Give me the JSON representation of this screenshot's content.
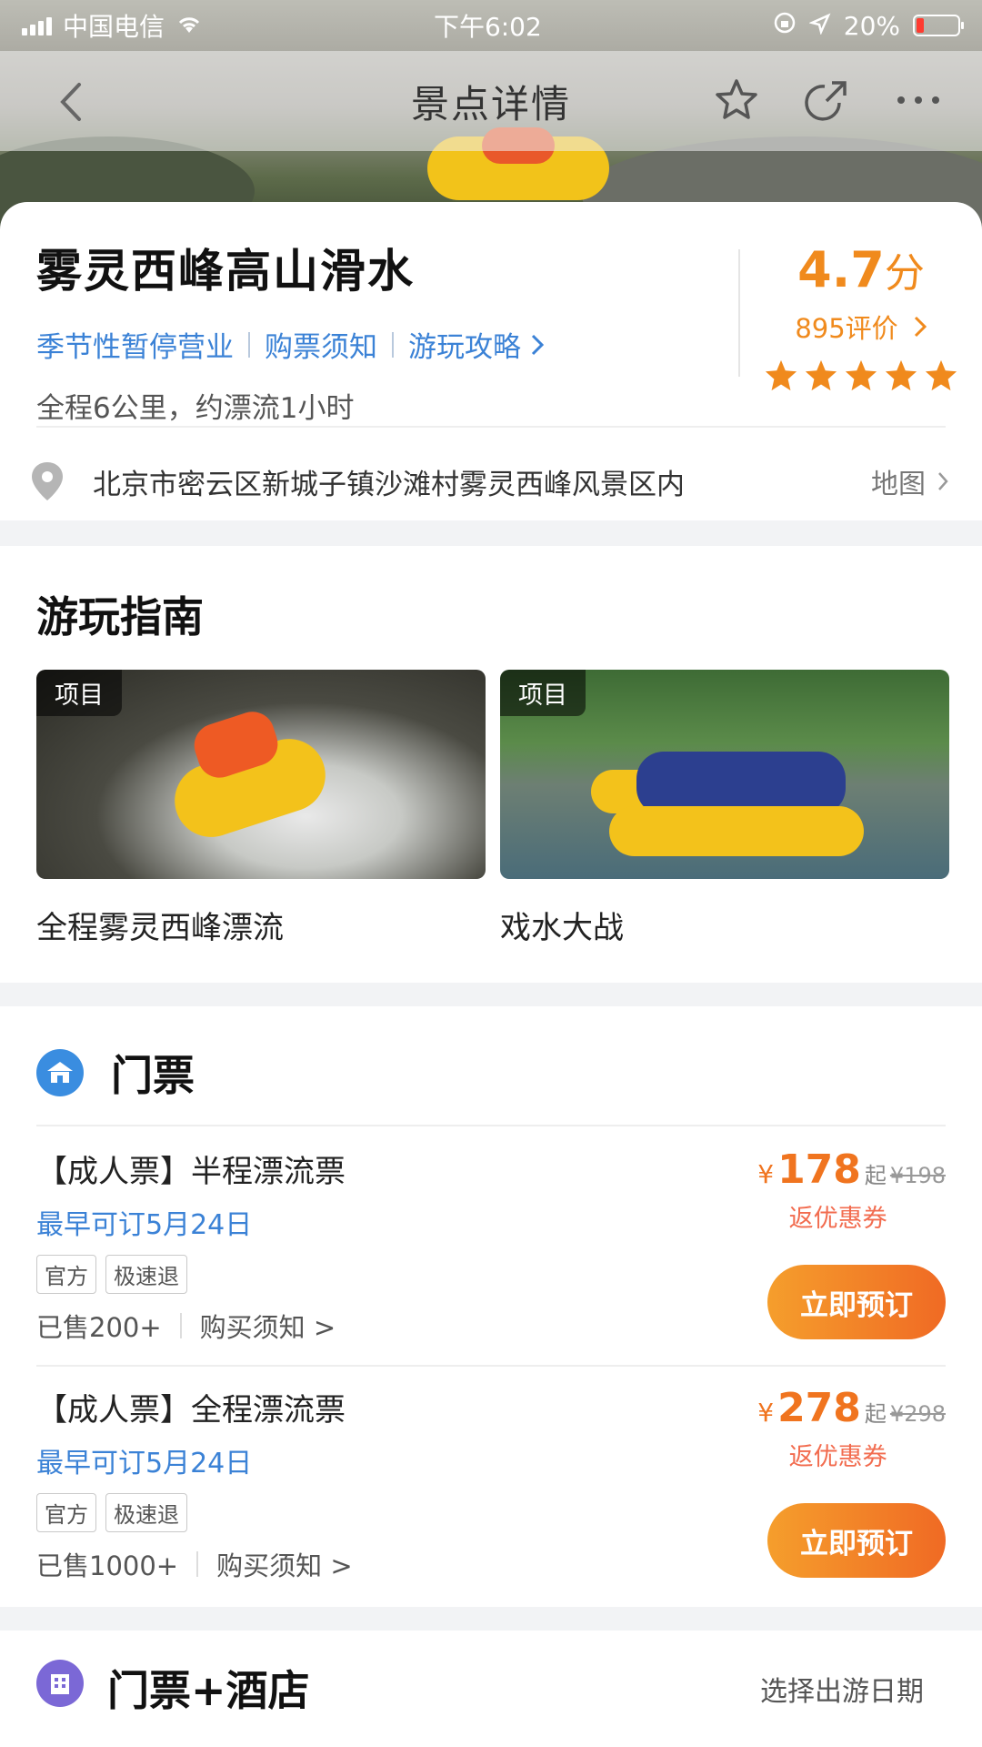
{
  "status_bar": {
    "carrier": "中国电信",
    "time": "下午6:02",
    "battery": "20%"
  },
  "nav": {
    "title": "景点详情"
  },
  "spot": {
    "name": "雾灵西峰高山滑水",
    "links": [
      "季节性暂停营业",
      "购票须知",
      "游玩攻略"
    ],
    "description": "全程6公里，约漂流1小时",
    "score": "4.7",
    "score_unit": "分",
    "reviews": "895评价",
    "stars": 5,
    "address": "北京市密云区新城子镇沙滩村雾灵西峰风景区内",
    "map_label": "地图"
  },
  "guide": {
    "title": "游玩指南",
    "items": [
      {
        "tag": "项目",
        "caption": "全程雾灵西峰漂流"
      },
      {
        "tag": "项目",
        "caption": "戏水大战"
      }
    ]
  },
  "tickets": {
    "title": "门票",
    "items": [
      {
        "name": "【成人票】半程漂流票",
        "date": "最早可订5月24日",
        "tags": [
          "官方",
          "极速退"
        ],
        "sold": "已售200+",
        "notice": "购买须知 >",
        "currency": "¥",
        "price": "178",
        "from": "起",
        "original": "¥198",
        "coupon": "返优惠券",
        "button": "立即预订"
      },
      {
        "name": "【成人票】全程漂流票",
        "date": "最早可订5月24日",
        "tags": [
          "官方",
          "极速退"
        ],
        "sold": "已售1000+",
        "notice": "购买须知 >",
        "currency": "¥",
        "price": "278",
        "from": "起",
        "original": "¥298",
        "coupon": "返优惠券",
        "button": "立即预订"
      }
    ]
  },
  "hotel": {
    "title": "门票+酒店",
    "action": "选择出游日期"
  },
  "colors": {
    "accent_orange": "#f08a1d",
    "link_blue": "#3b82d6",
    "ticket_icon": "#3a8de0",
    "hotel_icon": "#7b68d6"
  }
}
